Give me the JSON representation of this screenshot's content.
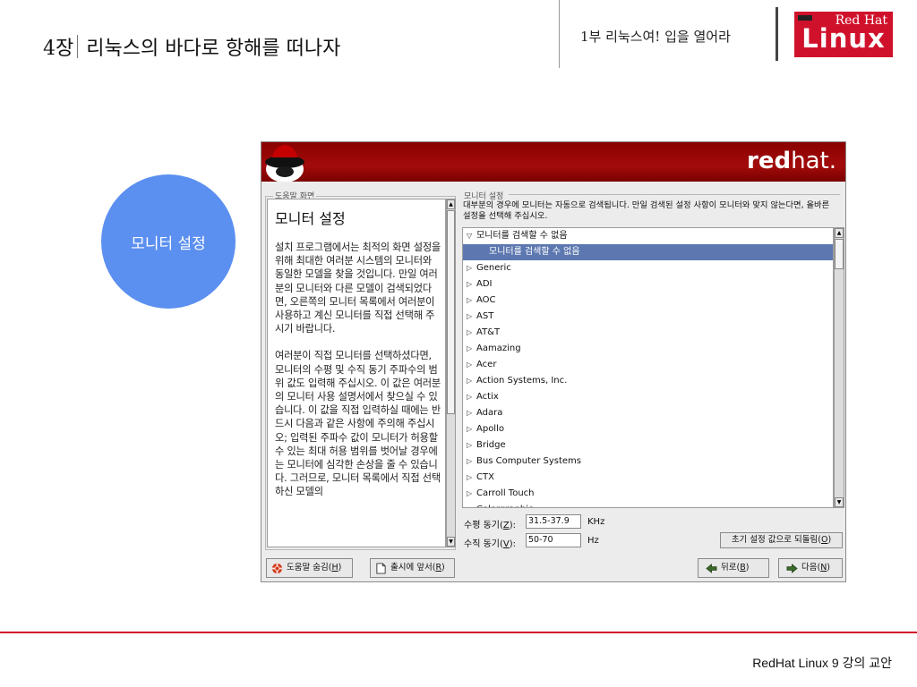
{
  "slide": {
    "chapter_num": "4장",
    "chapter_title": "리눅스의 바다로 항해를 떠나자",
    "part_title": "1부 리눅스여! 입을 열어라",
    "logo_text": "Linux",
    "logo_script": "Red Hat",
    "badge_label": "모니터 설정",
    "footer": "RedHat Linux 9 강의 교안"
  },
  "installer": {
    "brand_bold": "red",
    "brand_light": "hat.",
    "help": {
      "frame_label": "도움말 화면",
      "heading": "모니터 설정",
      "paragraphs": [
        "설치 프로그램에서는 최적의 화면 설정을 위해 최대한 여러분 시스템의 모니터와 동일한 모델을 찾을 것입니다. 만일 여러분의 모니터와 다른 모델이 검색되었다면, 오른쪽의 모니터 목록에서 여러분이 사용하고 계신 모니터를 직접 선택해 주시기 바랍니다.",
        "여러분이 직접 모니터를 선택하셨다면, 모니터의 수평 및 수직 동기 주파수의 범위 값도 입력해 주십시오. 이 값은 여러분의 모니터 사용 설명서에서 찾으실 수 있습니다. 이 값을 직접 입력하실 때에는 반드시 다음과 같은 사항에 주의해 주십시오; 입력된 주파수 값이 모니터가 허용할 수 있는 최대 허용 범위를 벗어날 경우에는 모니터에 심각한 손상을 줄 수 있습니다. 그러므로, 모니터 목록에서 직접 선택하신 모델의"
      ]
    },
    "monitor": {
      "frame_label": "모니터 설정",
      "description": "대부분의 경우에 모니터는 자동으로 검색됩니다. 만일 검색된 설정 사항이 모니터와 맞지 않는다면, 올바른 설정을 선택해 주십시오.",
      "expanded_group": "모니터를 검색할 수 없음",
      "selected_item": "모니터를 검색할 수 없음",
      "groups": [
        "Generic",
        "ADI",
        "AOC",
        "AST",
        "AT&T",
        "Aamazing",
        "Acer",
        "Action Systems, Inc.",
        "Actix",
        "Adara",
        "Apollo",
        "Bridge",
        "Bus Computer Systems",
        "CTX",
        "Carroll Touch",
        "Colorgraphic"
      ]
    },
    "sync": {
      "horizontal_label": "수평 동기(",
      "horizontal_key": "Z",
      "horizontal_suffix": "):",
      "horizontal_value": "31.5-37.9",
      "horizontal_unit": "KHz",
      "vertical_label": "수직 동기(",
      "vertical_key": "V",
      "vertical_suffix": "):",
      "vertical_value": "50-70",
      "vertical_unit": "Hz",
      "reset_label": "초기 설정 값으로 되돌림(",
      "reset_key": "O",
      "reset_suffix": ")"
    },
    "buttons": {
      "hide_help": "도움말 숨김(",
      "hide_help_key": "H",
      "release_notes": "출시에 앞서(",
      "release_notes_key": "R",
      "back": "뒤로(",
      "back_key": "B",
      "next": "다음(",
      "next_key": "N",
      "close_paren": ")"
    }
  }
}
